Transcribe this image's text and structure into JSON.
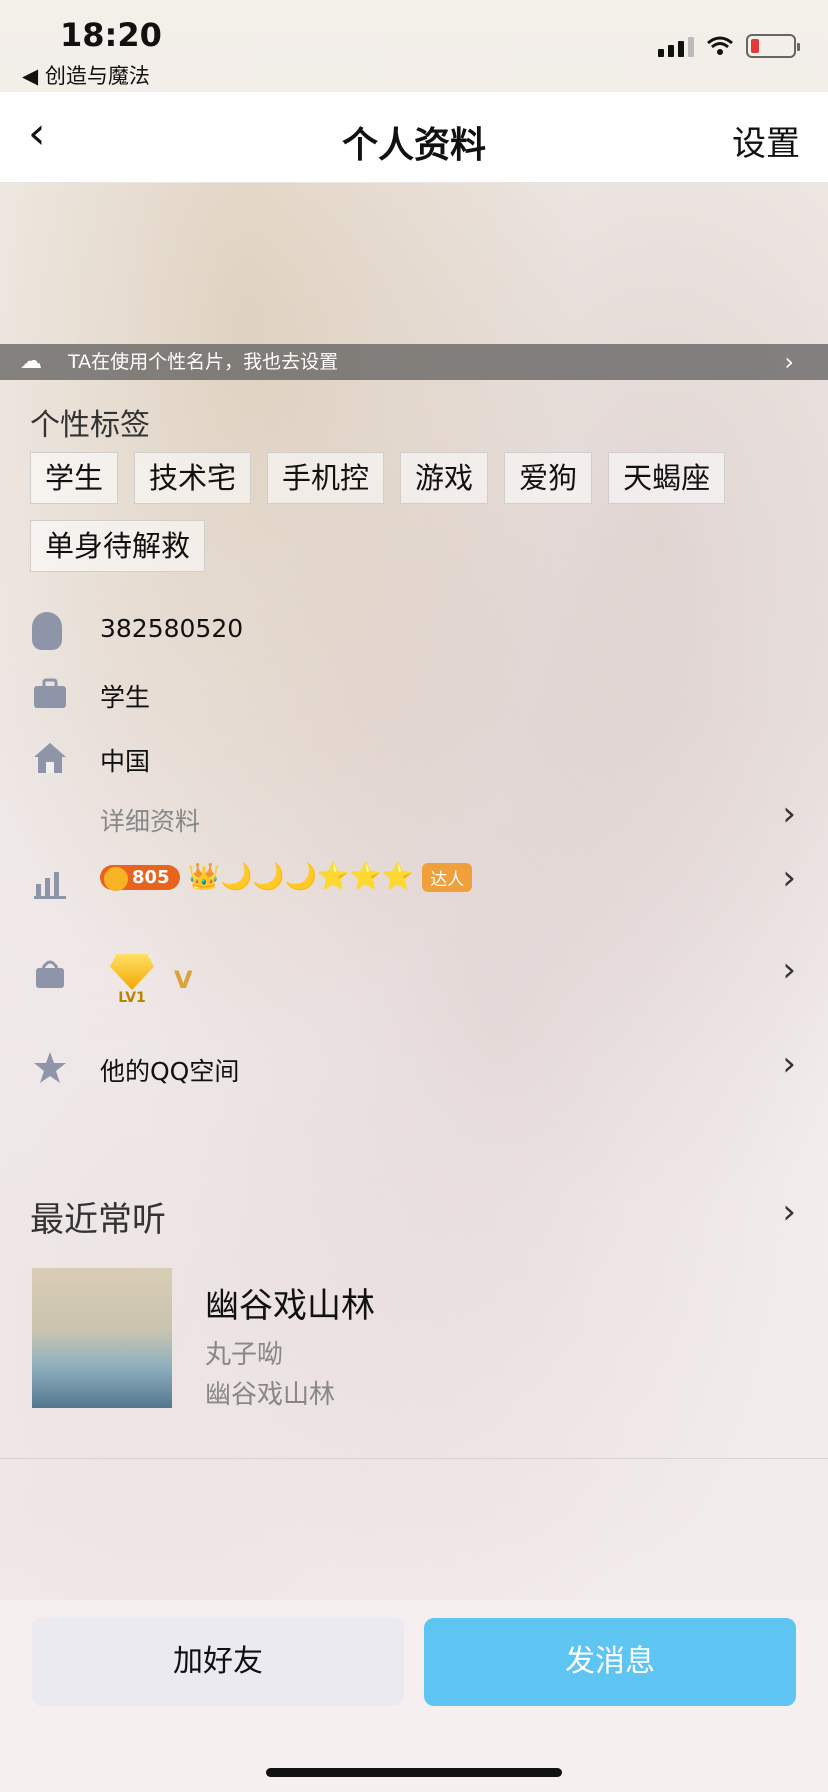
{
  "status_bar": {
    "time": "18:20",
    "back_app": "◀ 创造与魔法"
  },
  "nav": {
    "back_icon": "‹",
    "title": "个人资料",
    "settings": "设置"
  },
  "banner": {
    "text": "TA在使用个性名片，我也去设置",
    "chevron": "›"
  },
  "profile": {
    "tags_title": "个性标签",
    "tags": [
      "学生",
      "技术宅",
      "手机控",
      "游戏",
      "爱狗",
      "天蝎座",
      "单身待解救"
    ],
    "qq_number": "382580520",
    "occupation": "学生",
    "location": "中国",
    "detail_link": "详细资料",
    "level_badge": "805",
    "level_icons": "👑🌙🌙🌙⭐⭐⭐",
    "daren_label": "达人",
    "vip_level": "LV1",
    "vip_mark": "V",
    "qzone_link": "他的QQ空间"
  },
  "recent": {
    "title": "最近常听",
    "song": "幽谷戏山林",
    "artist": "丸子呦",
    "album": "幽谷戏山林"
  },
  "buttons": {
    "add_friend": "加好友",
    "send_message": "发消息"
  }
}
